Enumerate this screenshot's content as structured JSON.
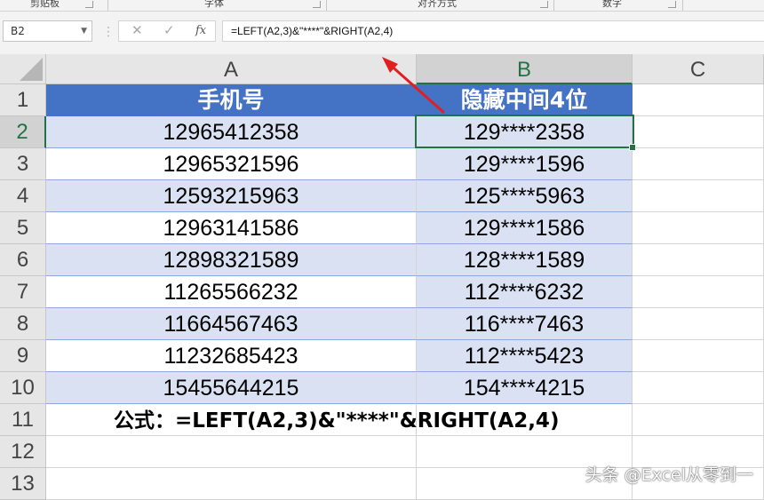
{
  "ribbon": {
    "groups": [
      "剪贴板",
      "字体",
      "对齐方式",
      "数字"
    ]
  },
  "formula_bar": {
    "name_box": "B2",
    "cancel_icon": "✕",
    "enter_icon": "✓",
    "fx_label": "fx",
    "formula": "=LEFT(A2,3)&\"****\"&RIGHT(A2,4)"
  },
  "columns": [
    "A",
    "B",
    "C"
  ],
  "rows": [
    "1",
    "2",
    "3",
    "4",
    "5",
    "6",
    "7",
    "8",
    "9",
    "10",
    "11",
    "12",
    "13"
  ],
  "table": {
    "header": [
      "手机号",
      "隐藏中间4位"
    ],
    "data": [
      [
        "12965412358",
        "129****2358"
      ],
      [
        "12965321596",
        "129****1596"
      ],
      [
        "12593215963",
        "125****5963"
      ],
      [
        "12963141586",
        "129****1586"
      ],
      [
        "12898321589",
        "128****1589"
      ],
      [
        "11265566232",
        "112****6232"
      ],
      [
        "11664567463",
        "116****7463"
      ],
      [
        "11232685423",
        "112****5423"
      ],
      [
        "15455644215",
        "154****4215"
      ]
    ]
  },
  "note": "公式：=LEFT(A2,3)&\"****\"&RIGHT(A2,4)",
  "watermark": "头条 @Excel从零到一",
  "selected_cell": "B2",
  "colors": {
    "header_fill": "#4472c4",
    "band_fill": "#d9e1f2",
    "selection": "#217346",
    "arrow": "#e02020"
  }
}
